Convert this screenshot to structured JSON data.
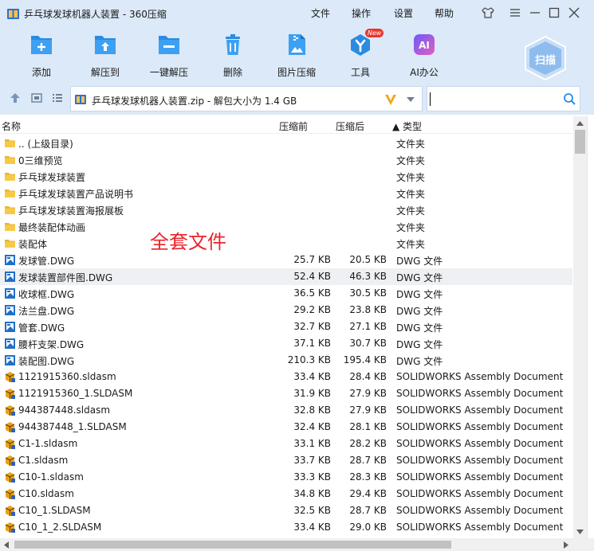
{
  "window": {
    "title": "乒乓球发球机器人装置 - 360压缩"
  },
  "menu": {
    "file": "文件",
    "operate": "操作",
    "settings": "设置",
    "help": "帮助"
  },
  "toolbar": {
    "add": "添加",
    "extract_to": "解压到",
    "one_click_extract": "一键解压",
    "delete": "删除",
    "image_compress": "图片压缩",
    "tools": "工具",
    "tools_badge": "New",
    "ai_office": "AI办公",
    "scan": "扫描"
  },
  "address": {
    "path": "乒乓球发球机器人装置.zip - 解包大小为 1.4 GB"
  },
  "search": {
    "value": ""
  },
  "columns": {
    "name": "名称",
    "before": "压缩前",
    "after": "压缩后",
    "type": "▲ 类型"
  },
  "annotation": "全套文件",
  "files": [
    {
      "icon": "folder",
      "name": ".. (上级目录)",
      "before": "",
      "after": "",
      "type": "文件夹"
    },
    {
      "icon": "folder",
      "name": "0三维预览",
      "before": "",
      "after": "",
      "type": "文件夹"
    },
    {
      "icon": "folder",
      "name": "乒乓球发球装置",
      "before": "",
      "after": "",
      "type": "文件夹"
    },
    {
      "icon": "folder",
      "name": "乒乓球发球装置产品说明书",
      "before": "",
      "after": "",
      "type": "文件夹"
    },
    {
      "icon": "folder",
      "name": "乒乓球发球装置海报展板",
      "before": "",
      "after": "",
      "type": "文件夹"
    },
    {
      "icon": "folder",
      "name": "最终装配体动画",
      "before": "",
      "after": "",
      "type": "文件夹"
    },
    {
      "icon": "folder",
      "name": "装配体",
      "before": "",
      "after": "",
      "type": "文件夹"
    },
    {
      "icon": "dwg",
      "name": "发球管.DWG",
      "before": "25.7 KB",
      "after": "20.5 KB",
      "type": "DWG 文件"
    },
    {
      "icon": "dwg",
      "name": "发球装置部件图.DWG",
      "before": "52.4 KB",
      "after": "46.3 KB",
      "type": "DWG 文件"
    },
    {
      "icon": "dwg",
      "name": "收球框.DWG",
      "before": "36.5 KB",
      "after": "30.5 KB",
      "type": "DWG 文件"
    },
    {
      "icon": "dwg",
      "name": "法兰盘.DWG",
      "before": "29.2 KB",
      "after": "23.8 KB",
      "type": "DWG 文件"
    },
    {
      "icon": "dwg",
      "name": "管套.DWG",
      "before": "32.7 KB",
      "after": "27.1 KB",
      "type": "DWG 文件"
    },
    {
      "icon": "dwg",
      "name": "腰杆支架.DWG",
      "before": "37.1 KB",
      "after": "30.7 KB",
      "type": "DWG 文件"
    },
    {
      "icon": "dwg",
      "name": "装配图.DWG",
      "before": "210.3 KB",
      "after": "195.4 KB",
      "type": "DWG 文件"
    },
    {
      "icon": "sldasm",
      "name": "1121915360.sldasm",
      "before": "33.4 KB",
      "after": "28.4 KB",
      "type": "SOLIDWORKS Assembly Document"
    },
    {
      "icon": "sldasm",
      "name": "1121915360_1.SLDASM",
      "before": "31.9 KB",
      "after": "27.9 KB",
      "type": "SOLIDWORKS Assembly Document"
    },
    {
      "icon": "sldasm",
      "name": "944387448.sldasm",
      "before": "32.8 KB",
      "after": "27.9 KB",
      "type": "SOLIDWORKS Assembly Document"
    },
    {
      "icon": "sldasm",
      "name": "944387448_1.SLDASM",
      "before": "32.4 KB",
      "after": "28.1 KB",
      "type": "SOLIDWORKS Assembly Document"
    },
    {
      "icon": "sldasm",
      "name": "C1-1.sldasm",
      "before": "33.1 KB",
      "after": "28.2 KB",
      "type": "SOLIDWORKS Assembly Document"
    },
    {
      "icon": "sldasm",
      "name": "C1.sldasm",
      "before": "33.7 KB",
      "after": "28.7 KB",
      "type": "SOLIDWORKS Assembly Document"
    },
    {
      "icon": "sldasm",
      "name": "C10-1.sldasm",
      "before": "33.3 KB",
      "after": "28.3 KB",
      "type": "SOLIDWORKS Assembly Document"
    },
    {
      "icon": "sldasm",
      "name": "C10.sldasm",
      "before": "34.8 KB",
      "after": "29.4 KB",
      "type": "SOLIDWORKS Assembly Document"
    },
    {
      "icon": "sldasm",
      "name": "C10_1.SLDASM",
      "before": "32.5 KB",
      "after": "28.7 KB",
      "type": "SOLIDWORKS Assembly Document"
    },
    {
      "icon": "sldasm",
      "name": "C10_1_2.SLDASM",
      "before": "33.4 KB",
      "after": "29.0 KB",
      "type": "SOLIDWORKS Assembly Document"
    }
  ],
  "highlighted_row": 8,
  "colors": {
    "chrome": "#dbe9f8",
    "accent": "#2b8be0",
    "annotation": "#e8242a",
    "folder": "#f7c948"
  }
}
